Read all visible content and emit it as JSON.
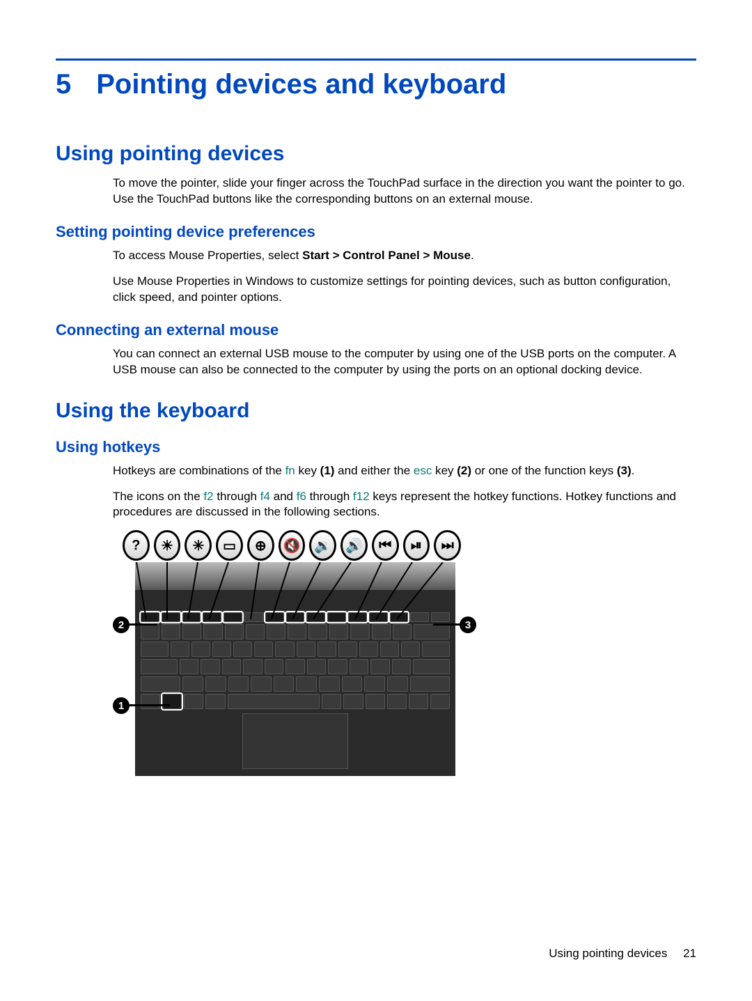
{
  "chapter": {
    "number": "5",
    "title": "Pointing devices and keyboard"
  },
  "section_pointing": {
    "heading": "Using pointing devices",
    "intro": "To move the pointer, slide your finger across the TouchPad surface in the direction you want the pointer to go. Use the TouchPad buttons like the corresponding buttons on an external mouse.",
    "prefs_heading": "Setting pointing device preferences",
    "prefs_line_pre": "To access Mouse Properties, select ",
    "prefs_line_bold": "Start > Control Panel > Mouse",
    "prefs_line_post": ".",
    "prefs_body": "Use Mouse Properties in Windows to customize settings for pointing devices, such as button configuration, click speed, and pointer options.",
    "ext_heading": "Connecting an external mouse",
    "ext_body": "You can connect an external USB mouse to the computer by using one of the USB ports on the computer. A USB mouse can also be connected to the computer by using the ports on an optional docking device."
  },
  "section_keyboard": {
    "heading": "Using the keyboard",
    "hotkeys_heading": "Using hotkeys",
    "hk1": {
      "a": "Hotkeys are combinations of the ",
      "fn": "fn",
      "b": " key ",
      "b1": "(1)",
      "c": " and either the ",
      "esc": "esc",
      "d": " key ",
      "d1": "(2)",
      "e": " or one of the function keys ",
      "e1": "(3)",
      "f": "."
    },
    "hk2": {
      "a": "The icons on the ",
      "f2": "f2",
      "b": " through ",
      "f4": "f4",
      "c": " and ",
      "f6": "f6",
      "d": " through ",
      "f12": "f12",
      "e": " keys represent the hotkey functions. Hotkey functions and procedures are discussed in the following sections."
    }
  },
  "diagram": {
    "icons": [
      "?",
      "☀",
      "✳",
      "▭",
      "⊕",
      "🔇",
      "🔉",
      "🔊",
      "⏮",
      "⏯",
      "⏭"
    ],
    "callouts": {
      "one": "1",
      "two": "2",
      "three": "3"
    }
  },
  "footer": {
    "label": "Using pointing devices",
    "page": "21"
  }
}
